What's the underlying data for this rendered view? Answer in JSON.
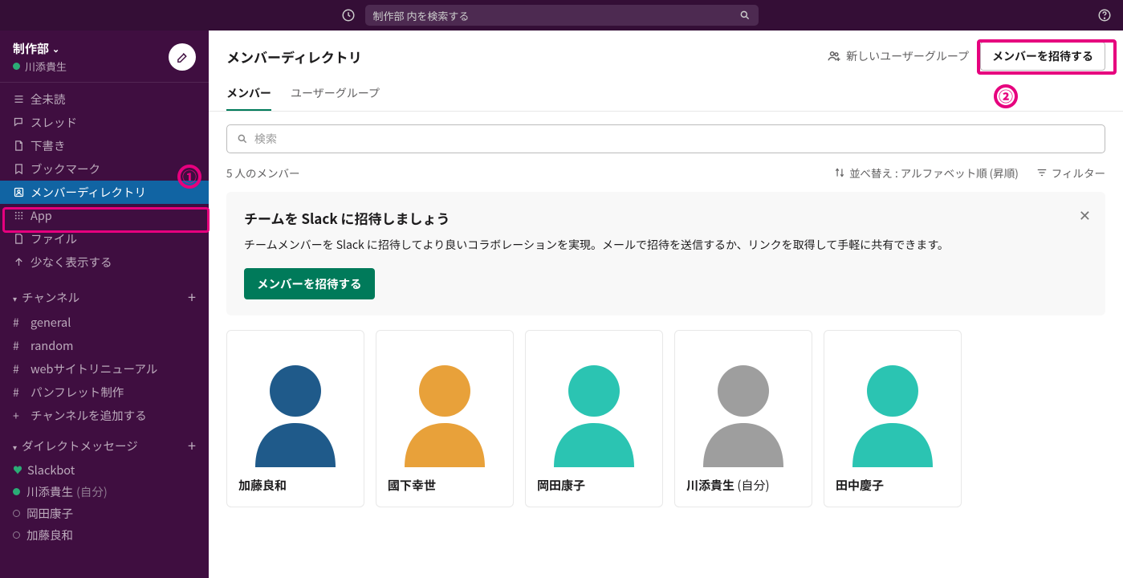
{
  "topbar": {
    "search_placeholder": "制作部 内を検索する"
  },
  "workspace": {
    "name": "制作部",
    "user": "川添貴生"
  },
  "sidebar_nav": [
    {
      "icon": "≡",
      "label": "全未読"
    },
    {
      "icon": "◎",
      "label": "スレッド"
    },
    {
      "icon": "⎘",
      "label": "下書き"
    },
    {
      "icon": "⟋",
      "label": "ブックマーク"
    },
    {
      "icon": "⧉",
      "label": "メンバーディレクトリ",
      "active": true
    },
    {
      "icon": "⠿",
      "label": "App"
    },
    {
      "icon": "⎘",
      "label": "ファイル"
    },
    {
      "icon": "↑",
      "label": "少なく表示する"
    }
  ],
  "channels_header": "チャンネル",
  "channels": [
    "general",
    "random",
    "webサイトリニューアル",
    "パンフレット制作"
  ],
  "add_channel": "チャンネルを追加する",
  "dm_header": "ダイレクトメッセージ",
  "dms": [
    {
      "name": "Slackbot",
      "status": "heart"
    },
    {
      "name": "川添貴生",
      "status": "green",
      "self": "(自分)"
    },
    {
      "name": "岡田康子",
      "status": "gray"
    },
    {
      "name": "加藤良和",
      "status": "gray"
    }
  ],
  "main": {
    "title": "メンバーディレクトリ",
    "new_group": "新しいユーザーグループ",
    "invite_button": "メンバーを招待する",
    "tabs": {
      "members": "メンバー",
      "usergroups": "ユーザーグループ"
    },
    "search_placeholder": "検索",
    "count_text": "5 人のメンバー",
    "sort_label": "並べ替え : アルファベット順 (昇順)",
    "filter_label": "フィルター"
  },
  "banner": {
    "title": "チームを Slack に招待しましょう",
    "text": "チームメンバーを Slack に招待してより良いコラボレーションを実現。メールで招待を送信するか、リンクを取得して手軽に共有できます。",
    "button": "メンバーを招待する"
  },
  "members": [
    {
      "name": "加藤良和",
      "color": "#1f5a8a"
    },
    {
      "name": "國下幸世",
      "color": "#e8a13a"
    },
    {
      "name": "岡田康子",
      "color": "#2bc4b2"
    },
    {
      "name": "川添貴生",
      "self": " (自分)",
      "color": "#9e9e9e"
    },
    {
      "name": "田中慶子",
      "color": "#2bc4b2"
    }
  ],
  "annotations": {
    "one": "①",
    "two": "②"
  }
}
